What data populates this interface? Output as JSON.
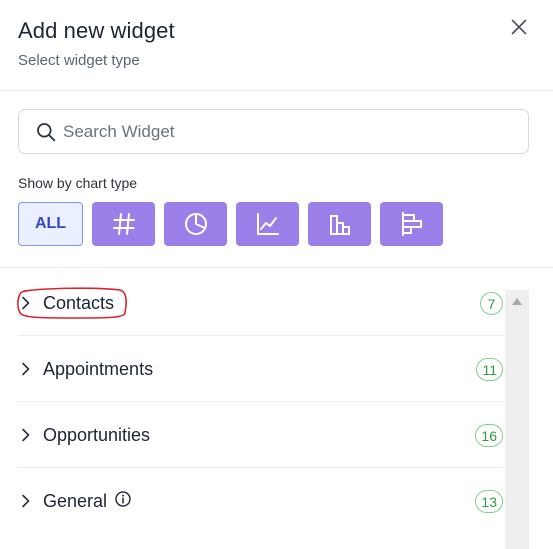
{
  "header": {
    "title": "Add new widget",
    "subtitle": "Select widget type"
  },
  "search": {
    "placeholder": "Search Widget",
    "value": ""
  },
  "chart_types": {
    "label": "Show by chart type",
    "all_label": "ALL",
    "active": "ALL",
    "buttons": [
      "number-icon",
      "pie-chart-icon",
      "line-chart-icon",
      "bar-chart-icon",
      "horizontal-bar-chart-icon"
    ]
  },
  "categories": [
    {
      "label": "Contacts",
      "count": "7"
    },
    {
      "label": "Appointments",
      "count": "11"
    },
    {
      "label": "Opportunities",
      "count": "16"
    },
    {
      "label": "General",
      "count": "13",
      "info": true
    }
  ],
  "colors": {
    "type_button": "#9b7fe8",
    "all_active_bg": "#eaf0ff",
    "all_active_text": "#2f49c9",
    "badge": "#2f9b45",
    "annotation": "#d9262e"
  }
}
